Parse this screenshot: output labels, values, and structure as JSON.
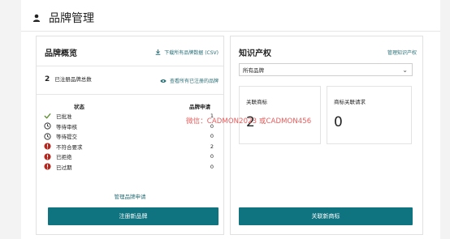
{
  "page": {
    "title": "品牌管理"
  },
  "overview": {
    "title": "品牌概览",
    "download_label": "下载所有品牌数据 (CSV)",
    "registered_count": "2",
    "registered_label": "已注册品牌总数",
    "view_all_label": "查看所有已注册的品牌",
    "status_header": "状态",
    "requests_header": "品牌申请",
    "statuses": [
      {
        "label": "已批准",
        "value": "1",
        "icon": "check-icon",
        "color": "#5a8a2a"
      },
      {
        "label": "等待审核",
        "value": "0",
        "icon": "clock-icon",
        "color": "#333333"
      },
      {
        "label": "等待提交",
        "value": "0",
        "icon": "clock-icon",
        "color": "#333333"
      },
      {
        "label": "不符合要求",
        "value": "2",
        "icon": "alert-icon",
        "color": "#b3261e"
      },
      {
        "label": "已拒绝",
        "value": "0",
        "icon": "alert-icon",
        "color": "#b3261e"
      },
      {
        "label": "已过期",
        "value": "0",
        "icon": "alert-icon",
        "color": "#b3261e"
      }
    ],
    "manage_link": "管理品牌申请",
    "register_button": "注册新品牌"
  },
  "ip": {
    "title": "知识产权",
    "manage_link": "管理知识产权",
    "select_value": "所有品牌",
    "linked_trademarks_label": "关联商标",
    "linked_trademarks_value": "2",
    "trademark_requests_label": "商标关联请求",
    "trademark_requests_value": "0",
    "link_button": "关联新商标"
  },
  "watermark": "微信：CADMON2023 或CADMON456",
  "colors": {
    "accent": "#0f7380",
    "link": "#2a6f77",
    "error": "#b3261e",
    "success": "#5a8a2a",
    "watermark": "#e85b5b"
  }
}
